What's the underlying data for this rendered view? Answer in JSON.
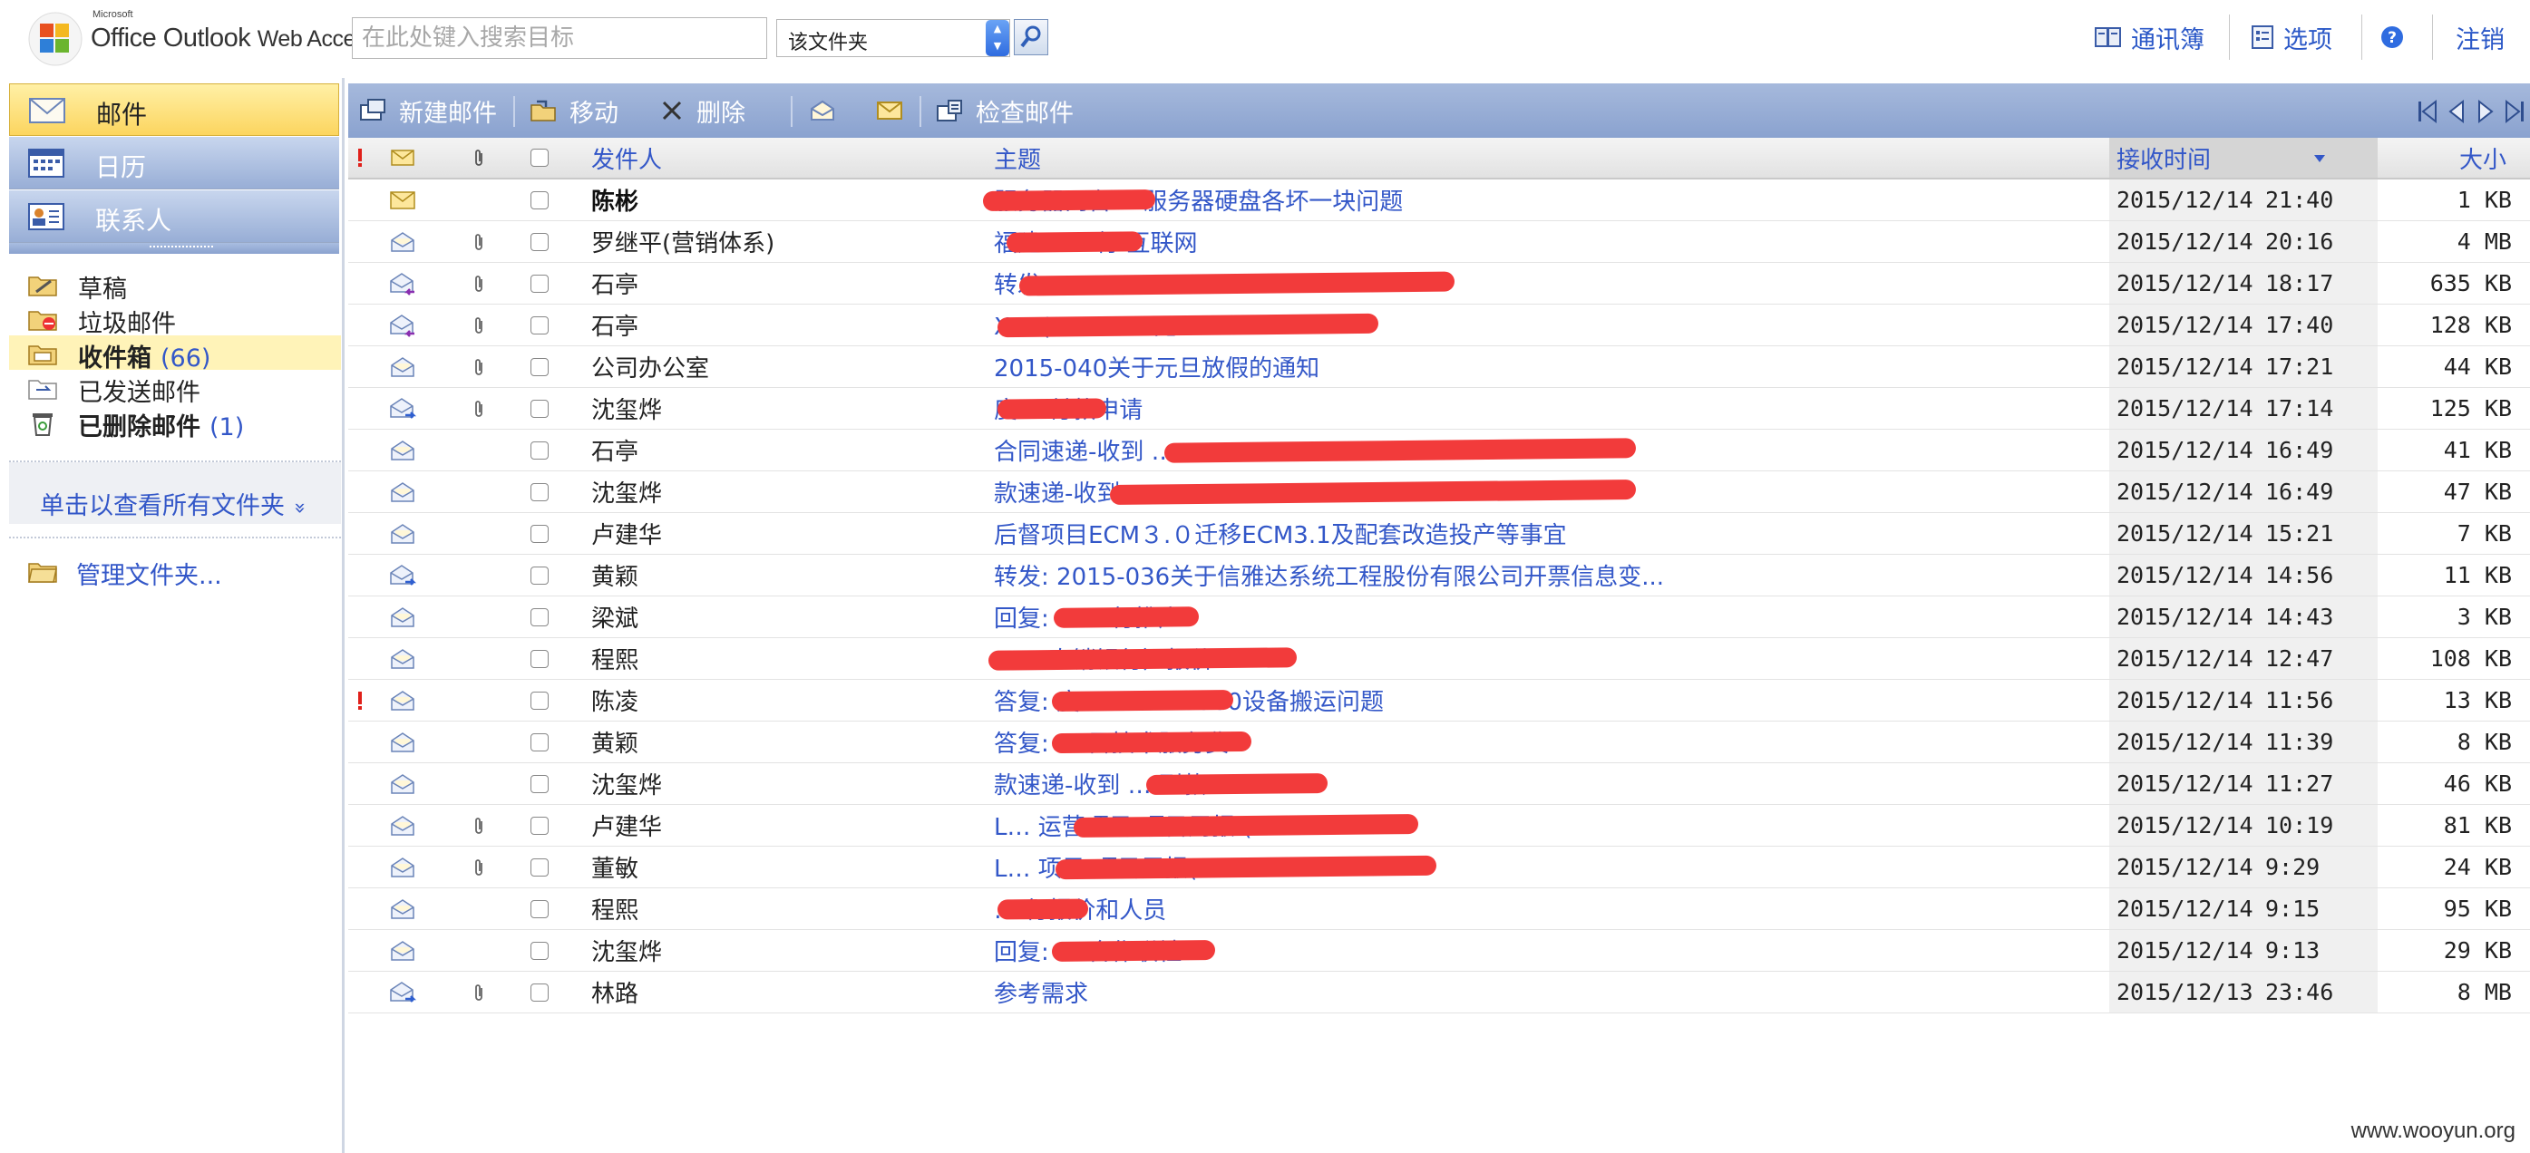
{
  "app": {
    "brand_small": "Microsoft",
    "brand_name": "Office Outlook",
    "brand_suffix": "Web Access"
  },
  "search": {
    "placeholder": "在此处键入搜索目标",
    "scope": "该文件夹"
  },
  "header_links": {
    "address_book": "通讯簿",
    "options": "选项",
    "logout": "注销"
  },
  "nav": {
    "mail": "邮件",
    "calendar": "日历",
    "contacts": "联系人"
  },
  "folders": [
    {
      "label": "草稿",
      "count": ""
    },
    {
      "label": "垃圾邮件",
      "count": ""
    },
    {
      "label": "收件箱",
      "count": "(66)"
    },
    {
      "label": "已发送邮件",
      "count": ""
    },
    {
      "label": "已删除邮件",
      "count": "(1)"
    }
  ],
  "sidebar": {
    "all_folders": "单击以查看所有文件夹",
    "all_folders_chevron": "»",
    "manage_folders": "管理文件夹..."
  },
  "toolbar": {
    "new_mail": "新建邮件",
    "move": "移动",
    "delete": "删除",
    "check_mail": "检查邮件"
  },
  "columns": {
    "from": "发件人",
    "subject": "主题",
    "received": "接收时间",
    "size": "大小"
  },
  "messages": [
    {
      "from": "陈彬",
      "subject": "服务器两台HP服务器硬盘各坏一块问题",
      "date": "2015/12/14",
      "time": "21:40",
      "size": "1 KB",
      "unread": true,
      "attachment": false,
      "important": false,
      "icon": "envelope-closed"
    },
    {
      "from": "罗继平(营销体系)",
      "subject": "福建…  …行 互联网",
      "date": "2015/12/14",
      "time": "20:16",
      "size": "4 MB",
      "unread": false,
      "attachment": true,
      "important": false,
      "icon": "envelope-open"
    },
    {
      "from": "石亭",
      "subject": "转发: ...                                    /X...",
      "date": "2015/12/14",
      "time": "18:17",
      "size": "635 KB",
      "unread": false,
      "attachment": true,
      "important": false,
      "icon": "envelope-reply"
    },
    {
      "from": "石亭",
      "subject": "X…                          (2015-YX-无...",
      "date": "2015/12/14",
      "time": "17:40",
      "size": "128 KB",
      "unread": false,
      "attachment": true,
      "important": false,
      "icon": "envelope-reply"
    },
    {
      "from": "公司办公室",
      "subject": "2015-040关于元旦放假的通知",
      "date": "2015/12/14",
      "time": "17:21",
      "size": "44 KB",
      "unread": false,
      "attachment": true,
      "important": false,
      "icon": "envelope-open"
    },
    {
      "from": "沈玺烨",
      "subject": "度…   付款申请",
      "date": "2015/12/14",
      "time": "17:14",
      "size": "125 KB",
      "unread": false,
      "attachment": true,
      "important": false,
      "icon": "envelope-forward"
    },
    {
      "from": "石亭",
      "subject": "合同速递-收到 …                                  ..",
      "date": "2015/12/14",
      "time": "16:49",
      "size": "41 KB",
      "unread": false,
      "attachment": false,
      "important": false,
      "icon": "envelope-open"
    },
    {
      "from": "沈玺烨",
      "subject": "款速递-收到 …                                  ...",
      "date": "2015/12/14",
      "time": "16:49",
      "size": "47 KB",
      "unread": false,
      "attachment": false,
      "important": false,
      "icon": "envelope-open"
    },
    {
      "from": "卢建华",
      "subject": "后督项目ECM３.０迁移ECM3.1及配套改造投产等事宜",
      "date": "2015/12/14",
      "time": "15:21",
      "size": "7 KB",
      "unread": false,
      "attachment": false,
      "important": false,
      "icon": "envelope-open"
    },
    {
      "from": "黄颖",
      "subject": "转发: 2015-036关于信雅达系统工程股份有限公司开票信息变...",
      "date": "2015/12/14",
      "time": "14:56",
      "size": "11 KB",
      "unread": false,
      "attachment": false,
      "important": false,
      "icon": "envelope-forward"
    },
    {
      "from": "梁斌",
      "subject": "回复: …       …行推广",
      "date": "2015/12/14",
      "time": "14:43",
      "size": "3 KB",
      "unread": false,
      "attachment": false,
      "important": false,
      "icon": "envelope-open"
    },
    {
      "from": "程熙",
      "subject": "…               …直销银行）报价",
      "date": "2015/12/14",
      "time": "12:47",
      "size": "108 KB",
      "unread": false,
      "attachment": false,
      "important": false,
      "icon": "envelope-open"
    },
    {
      "from": "陈凌",
      "subject": "答复: 度…          …UAP2980设备搬运问题",
      "date": "2015/12/14",
      "time": "11:56",
      "size": "13 KB",
      "unread": false,
      "attachment": false,
      "important": true,
      "icon": "envelope-open"
    },
    {
      "from": "黄颖",
      "subject": "答复: …          目技术服务费",
      "date": "2015/12/14",
      "time": "11:39",
      "size": "8 KB",
      "unread": false,
      "attachment": false,
      "important": false,
      "icon": "envelope-open"
    },
    {
      "from": "沈玺烨",
      "subject": "款速递-收到 …            到款",
      "date": "2015/12/14",
      "time": "11:27",
      "size": "46 KB",
      "unread": false,
      "attachment": false,
      "important": false,
      "icon": "envelope-open"
    },
    {
      "from": "卢建华",
      "subject": "L…                 运营项目-项目周报 (...",
      "date": "2015/12/14",
      "time": "10:19",
      "size": "81 KB",
      "unread": false,
      "attachment": true,
      "important": false,
      "icon": "envelope-open"
    },
    {
      "from": "董敏",
      "subject": "L…                 项目-项目周报(...",
      "date": "2015/12/14",
      "time": "9:29",
      "size": "24 KB",
      "unread": false,
      "attachment": true,
      "important": false,
      "icon": "envelope-open"
    },
    {
      "from": "程熙",
      "subject": "…   行报价和人员",
      "date": "2015/12/14",
      "time": "9:15",
      "size": "95 KB",
      "unread": false,
      "attachment": false,
      "important": false,
      "icon": "envelope-open"
    },
    {
      "from": "沈玺烨",
      "subject": "回复: …         合作联社",
      "date": "2015/12/14",
      "time": "9:13",
      "size": "29 KB",
      "unread": false,
      "attachment": false,
      "important": false,
      "icon": "envelope-open"
    },
    {
      "from": "林路",
      "subject": "参考需求",
      "date": "2015/12/13",
      "time": "23:46",
      "size": "8 MB",
      "unread": false,
      "attachment": true,
      "important": false,
      "icon": "envelope-forward"
    }
  ],
  "watermark": "www.wooyun.org",
  "colors": {
    "link_blue": "#3357c8",
    "toolbar_blue": "#8aa2cf",
    "selected_yellow": "#fcd55f",
    "redaction_red": "#f23b3b",
    "importance_red": "#e0201a"
  }
}
